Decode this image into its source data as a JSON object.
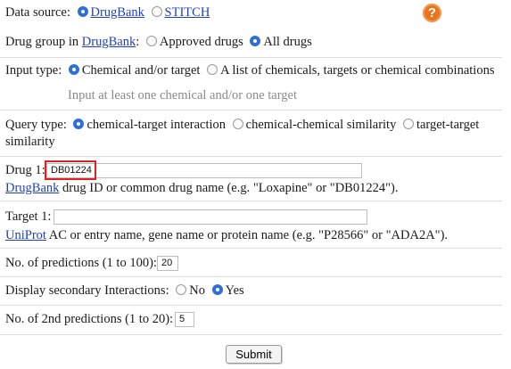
{
  "data_source": {
    "label": "Data source:",
    "options": [
      {
        "label": "DrugBank",
        "selected": true
      },
      {
        "label": "STITCH",
        "selected": false
      }
    ],
    "help_icon": "question-mark-icon",
    "help_symbol": "?"
  },
  "drug_group": {
    "label_prefix": "Drug group in",
    "link": "DrugBank",
    "label_suffix": ":",
    "options": [
      {
        "label": "Approved drugs",
        "selected": false
      },
      {
        "label": "All drugs",
        "selected": true
      }
    ]
  },
  "input_type": {
    "label": "Input type:",
    "options": [
      {
        "label": "Chemical and/or target",
        "selected": true
      },
      {
        "label": "A list of chemicals, targets or chemical combinations",
        "selected": false
      }
    ],
    "hint": "Input at least one chemical and/or one target"
  },
  "query_type": {
    "label": "Query type:",
    "options": [
      {
        "label": "chemical-target interaction",
        "selected": true
      },
      {
        "label": "chemical-chemical similarity",
        "selected": false
      },
      {
        "label": "target-target",
        "selected": false
      }
    ],
    "wrap_text": "similarity"
  },
  "drug1": {
    "label": "Drug 1:",
    "value": "DB01224",
    "help_link": "DrugBank",
    "help_text": "drug ID or common drug name (e.g. \"Loxapine\" or \"DB01224\")."
  },
  "target1": {
    "label": "Target 1:",
    "value": "",
    "help_link": "UniProt",
    "help_text": "AC or entry name, gene name or protein name (e.g. \"P28566\" or \"ADA2A\")."
  },
  "num_predictions": {
    "label": "No. of predictions (1 to 100):",
    "value": "20"
  },
  "secondary": {
    "label": "Display secondary Interactions:",
    "options": [
      {
        "label": "No",
        "selected": false
      },
      {
        "label": "Yes",
        "selected": true
      }
    ]
  },
  "num_2nd_predictions": {
    "label": "No. of 2nd predictions (1 to 20):",
    "value": "5"
  },
  "submit_label": "Submit",
  "colors": {
    "link": "#1f3fbf",
    "radio_selected": "#2f6fd6",
    "help_icon": "#e8741c",
    "highlight": "#e02020"
  }
}
